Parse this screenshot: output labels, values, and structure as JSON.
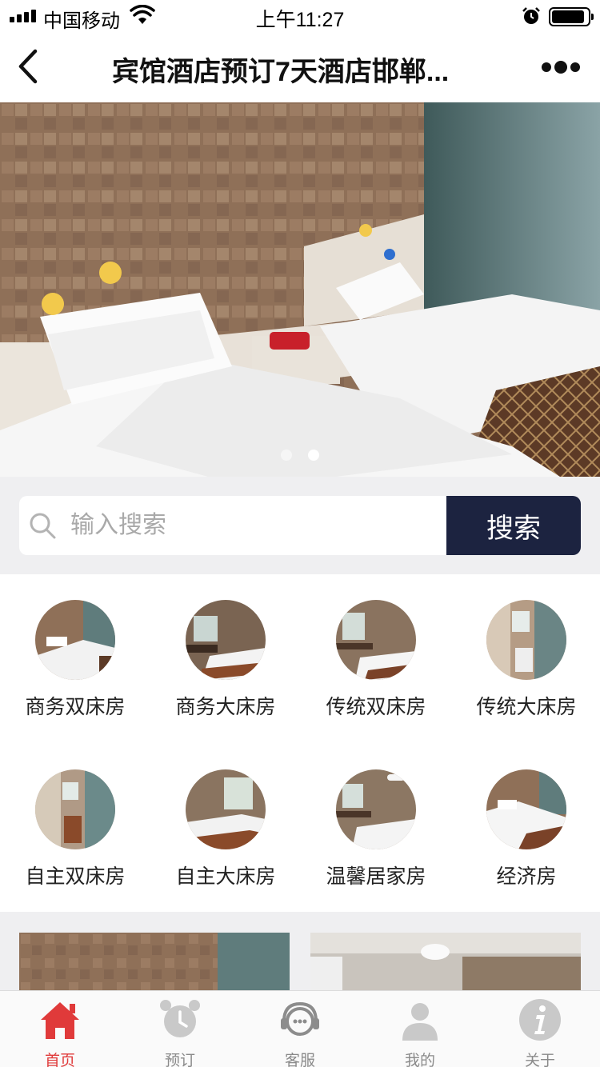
{
  "status_bar": {
    "carrier": "中国移动",
    "time": "上午11:27"
  },
  "nav": {
    "title": "宾馆酒店预订7天酒店邯郸..."
  },
  "banner": {
    "slide_count": 2,
    "active_index": 1
  },
  "search": {
    "placeholder": "输入搜索",
    "button_label": "搜索"
  },
  "categories": [
    {
      "label": "商务双床房"
    },
    {
      "label": "商务大床房"
    },
    {
      "label": "传统双床房"
    },
    {
      "label": "传统大床房"
    },
    {
      "label": "自主双床房"
    },
    {
      "label": "自主大床房"
    },
    {
      "label": "温馨居家房"
    },
    {
      "label": "经济房"
    }
  ],
  "tabs": [
    {
      "label": "首页",
      "icon": "home-icon",
      "active": true
    },
    {
      "label": "预订",
      "icon": "alarm-clock-icon",
      "active": false
    },
    {
      "label": "客服",
      "icon": "headset-icon",
      "active": false
    },
    {
      "label": "我的",
      "icon": "user-icon",
      "active": false
    },
    {
      "label": "关于",
      "icon": "info-icon",
      "active": false
    }
  ],
  "colors": {
    "accent": "#e03a3a",
    "search_button": "#1c2340",
    "tab_inactive": "#8a8a8a"
  }
}
